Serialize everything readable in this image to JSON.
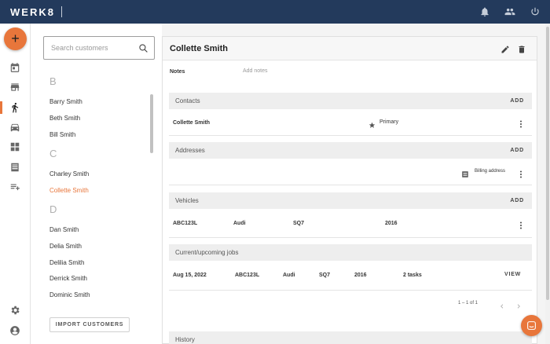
{
  "app": {
    "logo": "WERK8"
  },
  "topbar": {
    "icons": [
      "bell-icon",
      "people-icon",
      "power-icon"
    ]
  },
  "nav": {
    "fab_label": "+",
    "items": [
      "calendar-icon",
      "store-icon",
      "person-walking-icon",
      "car-icon",
      "dashboard-icon",
      "list-icon",
      "playlist-add-icon",
      "settings-icon",
      "account-icon"
    ],
    "active": "person-walking-icon"
  },
  "customers": {
    "search_placeholder": "Search customers",
    "groups": [
      {
        "letter": "B",
        "names": [
          "Barry Smith",
          "Beth Smith",
          "Bill Smith"
        ]
      },
      {
        "letter": "C",
        "names": [
          "Charley Smith",
          "Collette Smith"
        ]
      },
      {
        "letter": "D",
        "names": [
          "Dan Smith",
          "Delia Smith",
          "Delilia Smith",
          "Derrick Smith",
          "Dominic Smith"
        ]
      }
    ],
    "selected": "Collette Smith",
    "import_label": "IMPORT CUSTOMERS"
  },
  "detail": {
    "name": "Collette Smith",
    "notes_label": "Notes",
    "notes_placeholder": "Add notes",
    "contacts": {
      "title": "Contacts",
      "add_label": "ADD",
      "rows": [
        {
          "name": "Collette Smith",
          "tag": "Primary"
        }
      ]
    },
    "addresses": {
      "title": "Addresses",
      "add_label": "ADD",
      "rows": [
        {
          "tag": "Billing address"
        }
      ]
    },
    "vehicles": {
      "title": "Vehicles",
      "add_label": "ADD",
      "rows": [
        {
          "plate": "ABC123L",
          "make": "Audi",
          "model": "SQ7",
          "year": "2016"
        }
      ]
    },
    "jobs": {
      "title": "Current/upcoming jobs",
      "rows": [
        {
          "date": "Aug 15, 2022",
          "plate": "ABC123L",
          "make": "Audi",
          "model": "SQ7",
          "year": "2016",
          "tasks": "2 tasks",
          "action": "VIEW"
        }
      ],
      "pagination": "1 – 1 of 1"
    },
    "history": {
      "title": "History"
    }
  },
  "colors": {
    "accent": "#e8763b",
    "topbar": "#233a5c"
  }
}
